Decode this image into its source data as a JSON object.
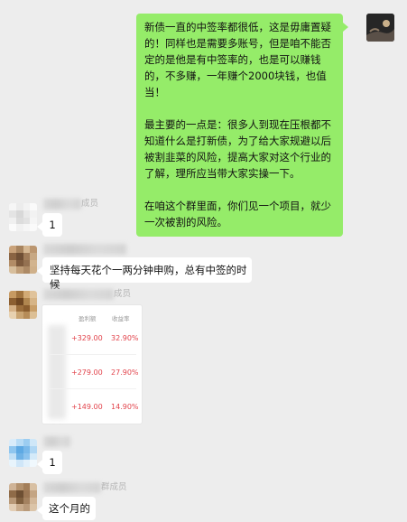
{
  "messages": {
    "outgoing": {
      "paragraphs": [
        "新债一直的中签率都很低，这是毋庸置疑的！同样也是需要多账号，但是咱不能否定的是他是有中签率的，也是可以赚钱的，不多赚，一年赚个2000块钱，也值当！",
        "最主要的一点是：很多人到现在压根都不知道什么是打新债，为了给大家规避以后被割韭菜的风险，提高大家对这个行业的了解，理所应当带大家实操一下。",
        "在咱这个群里面，你们见一个项目，就少一次被割的风险。"
      ]
    },
    "incoming": [
      {
        "name_suffix": "成员",
        "text": "1"
      },
      {
        "name_suffix": "",
        "text": "坚持每天花个一两分钟申购，总有中签的时候"
      },
      {
        "name_suffix": "成员",
        "card": {
          "headers": [
            "盈利额",
            "收益率"
          ],
          "rows": [
            {
              "profit": "+329.00",
              "rate": "32.90%"
            },
            {
              "profit": "+279.00",
              "rate": "27.90%"
            },
            {
              "profit": "+149.00",
              "rate": "14.90%"
            }
          ]
        }
      },
      {
        "name_suffix": "",
        "text": "1"
      },
      {
        "name_suffix": "群成员",
        "text": "这个月的"
      }
    ]
  },
  "colors": {
    "background": "#ededed",
    "outgoing_bubble": "#95ec69",
    "incoming_bubble": "#ffffff",
    "gain_red": "#e2434b"
  }
}
